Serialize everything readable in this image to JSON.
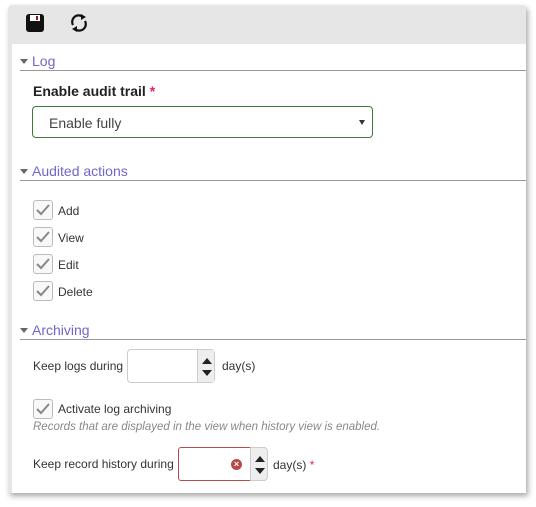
{
  "toolbar": {
    "save_icon": "floppy-disk-icon",
    "refresh_icon": "refresh-icon"
  },
  "log": {
    "title": "Log",
    "enable_label": "Enable audit trail",
    "required": "*",
    "select_value": "Enable fully"
  },
  "audited": {
    "title": "Audited actions",
    "items": [
      {
        "label": "Add",
        "checked": true
      },
      {
        "label": "View",
        "checked": true
      },
      {
        "label": "Edit",
        "checked": true
      },
      {
        "label": "Delete",
        "checked": true
      }
    ]
  },
  "archiving": {
    "title": "Archiving",
    "keep_logs_label": "Keep logs during",
    "keep_logs_value": "",
    "keep_logs_unit": "day(s)",
    "activate_label": "Activate log archiving",
    "activate_checked": true,
    "hint": "Records that are displayed in the view when history view is enabled.",
    "keep_history_label": "Keep record history during",
    "keep_history_value": "",
    "keep_history_unit": "day(s)",
    "required": "*"
  },
  "colors": {
    "section_title": "#7067c9",
    "select_border": "#3c7a3c",
    "error_border": "#b94a48",
    "required": "#e0245e"
  }
}
